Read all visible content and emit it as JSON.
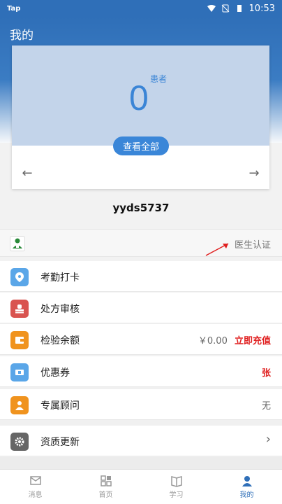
{
  "status": {
    "carrier": "Tap",
    "time": "10:53"
  },
  "header": {
    "title": "我的"
  },
  "card": {
    "count": "0",
    "count_label": "患者",
    "view_all": "查看全部"
  },
  "user": {
    "name": "yyds5737"
  },
  "verify": {
    "label": "医生认证"
  },
  "menu": [
    {
      "label": "考勤打卡",
      "icon": "location-pin-icon",
      "color": "#5aa6e8",
      "right": ""
    },
    {
      "label": "处方审核",
      "icon": "stamp-icon",
      "color": "#d9534f",
      "right": ""
    },
    {
      "label": "检验余额",
      "icon": "wallet-icon",
      "color": "#f0931e",
      "right": "￥0.00",
      "right_red": "立即充值"
    },
    {
      "label": "优惠券",
      "icon": "ticket-icon",
      "color": "#5aa6e8",
      "right": "",
      "right_red": "张"
    },
    {
      "label": "专属顾问",
      "icon": "advisor-icon",
      "color": "#f0931e",
      "right": "无"
    },
    {
      "label": "资质更新",
      "icon": "gear-icon",
      "color": "#666666",
      "right": "›"
    }
  ],
  "tabs": [
    {
      "label": "消息",
      "icon": "message-icon"
    },
    {
      "label": "首页",
      "icon": "home-grid-icon"
    },
    {
      "label": "学习",
      "icon": "book-icon"
    },
    {
      "label": "我的",
      "icon": "profile-icon",
      "active": true
    }
  ],
  "colors": {
    "primary": "#2f6fb8",
    "accent_red": "#e02020"
  }
}
